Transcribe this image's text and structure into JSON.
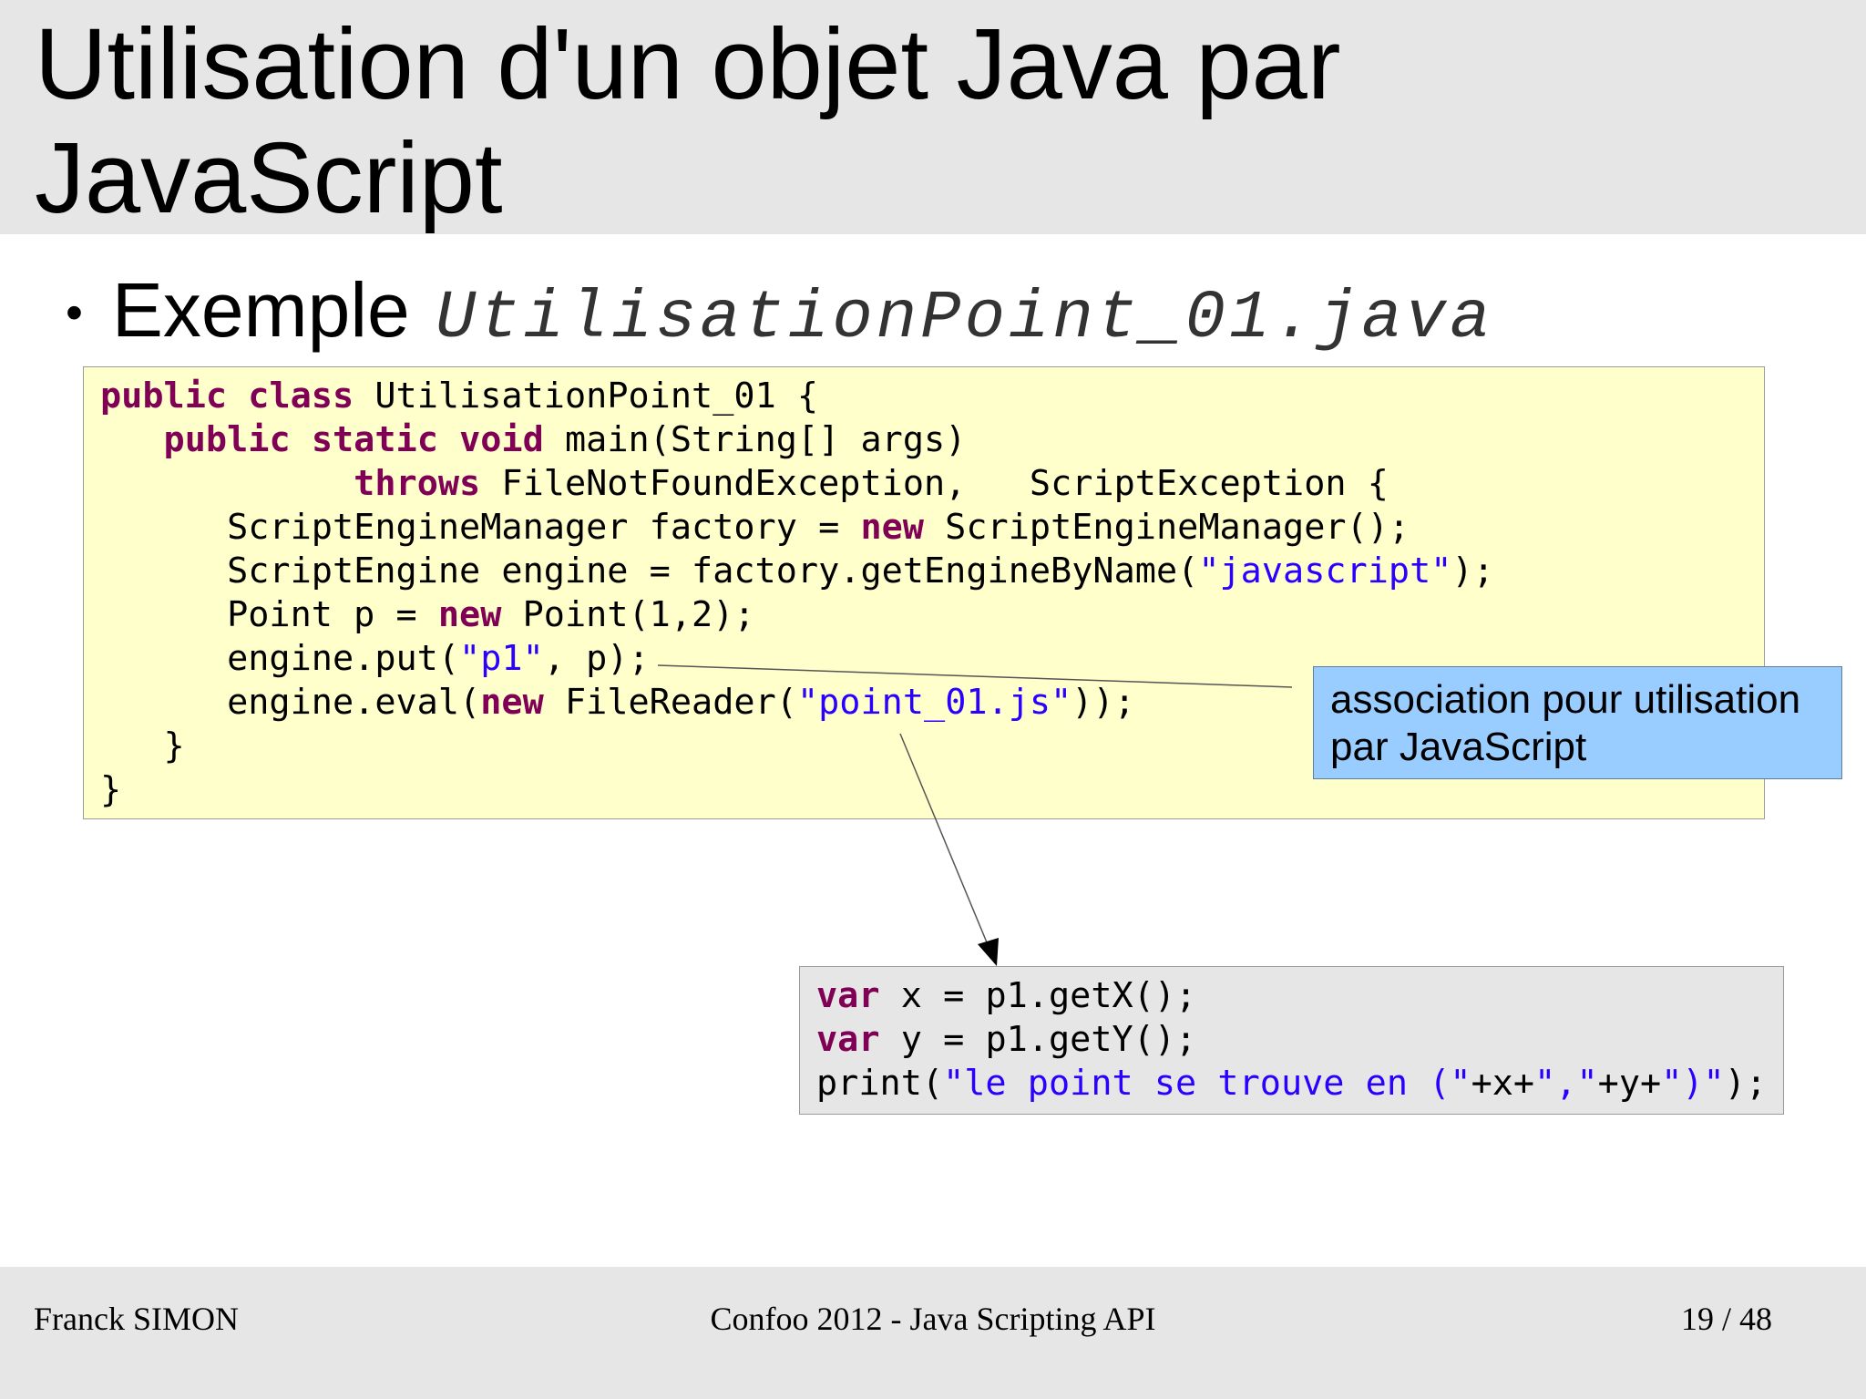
{
  "slide": {
    "title_line1": "Utilisation d'un objet Java par",
    "title_line2": "JavaScript",
    "bullet": {
      "symbol": "•",
      "text": "Exemple",
      "code": "UtilisationPoint_01.java"
    },
    "java_code": [
      [
        [
          "kw",
          "public"
        ],
        [
          "t",
          " "
        ],
        [
          "kw",
          "class"
        ],
        [
          "t",
          " UtilisationPoint_01 {"
        ]
      ],
      [
        [
          "t",
          "   "
        ],
        [
          "kw",
          "public"
        ],
        [
          "t",
          " "
        ],
        [
          "kw",
          "static"
        ],
        [
          "t",
          " "
        ],
        [
          "kw",
          "void"
        ],
        [
          "t",
          " main(String[] args)"
        ]
      ],
      [
        [
          "t",
          "            "
        ],
        [
          "kw",
          "throws"
        ],
        [
          "t",
          " FileNotFoundException,   ScriptException {"
        ]
      ],
      [
        [
          "t",
          "      ScriptEngineManager factory = "
        ],
        [
          "kw",
          "new"
        ],
        [
          "t",
          " ScriptEngineManager();"
        ]
      ],
      [
        [
          "t",
          "      ScriptEngine engine = factory.getEngineByName("
        ],
        [
          "str",
          "\"javascript\""
        ],
        [
          "t",
          ");"
        ]
      ],
      [
        [
          "t",
          "      Point p = "
        ],
        [
          "kw",
          "new"
        ],
        [
          "t",
          " Point(1,2);"
        ]
      ],
      [
        [
          "t",
          "      engine.put("
        ],
        [
          "str",
          "\"p1\""
        ],
        [
          "t",
          ", p);"
        ]
      ],
      [
        [
          "t",
          "      engine.eval("
        ],
        [
          "kw",
          "new"
        ],
        [
          "t",
          " FileReader("
        ],
        [
          "str",
          "\"point_01.js\""
        ],
        [
          "t",
          "));"
        ]
      ],
      [
        [
          "t",
          "   }"
        ]
      ],
      [
        [
          "t",
          "}"
        ]
      ]
    ],
    "js_code": [
      [
        [
          "kw",
          "var"
        ],
        [
          "t",
          " x = p1.getX();"
        ]
      ],
      [
        [
          "kw",
          "var"
        ],
        [
          "t",
          " y = p1.getY();"
        ]
      ],
      [
        [
          "t",
          "print("
        ],
        [
          "str",
          "\"le point se trouve en (\""
        ],
        [
          "t",
          "+x+"
        ],
        [
          "str",
          "\",\""
        ],
        [
          "t",
          "+y+"
        ],
        [
          "str",
          "\")\""
        ],
        [
          "t",
          ");"
        ]
      ]
    ],
    "callout_line1": "association pour utilisation",
    "callout_line2": "par JavaScript"
  },
  "footer": {
    "author": "Franck SIMON",
    "event": "Confoo 2012 - Java Scripting API",
    "page": "19 / 48"
  },
  "colors": {
    "title_bg": "#e6e6e6",
    "code_bg": "#ffffcc",
    "js_bg": "#e6e6e6",
    "callout_bg": "#99ccff",
    "keyword": "#7f0055",
    "string": "#2a00ff"
  }
}
